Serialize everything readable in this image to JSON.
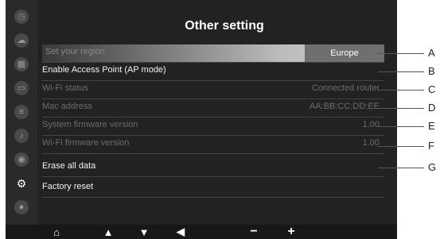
{
  "header": {
    "title": "Other setting"
  },
  "settings": {
    "region": {
      "label": "Set your region",
      "value": "Europe"
    },
    "ap_mode": {
      "label": "Enable Access Point (AP mode)"
    },
    "wifi_status": {
      "label": "Wi-Fi status",
      "value": "Connected router"
    },
    "mac": {
      "label": "Mac address",
      "value": "AA:BB:CC:DD:EE"
    },
    "system_fw": {
      "label": "System firmware version",
      "value": "1.00"
    },
    "wifi_fw": {
      "label": "Wi-Fi firmware version",
      "value": "1.00"
    },
    "erase": {
      "label": "Erase all data"
    },
    "factory": {
      "label": "Factory reset"
    }
  },
  "callouts": [
    "A",
    "B",
    "C",
    "D",
    "E",
    "F",
    "G"
  ],
  "bottom_bar": {
    "home": "⌂",
    "up": "▲",
    "down": "▼",
    "back": "◀",
    "minus": "−",
    "plus": "+"
  }
}
